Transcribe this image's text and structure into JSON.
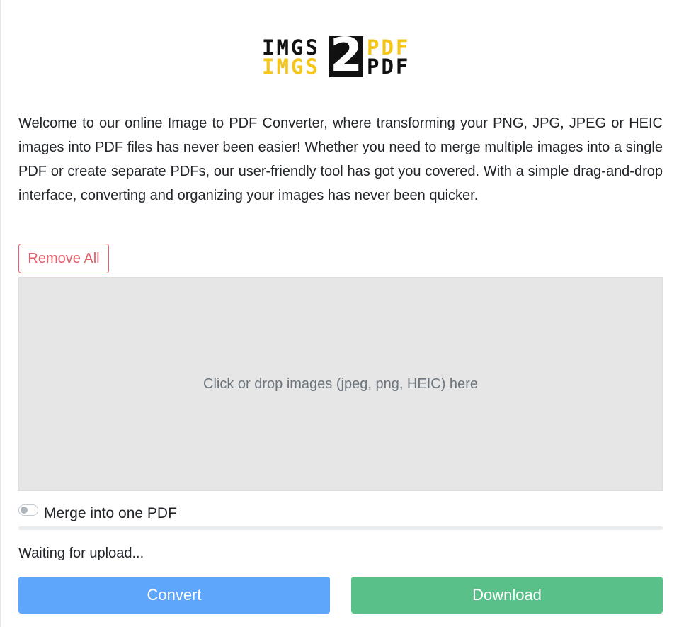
{
  "logo": {
    "imgs_top": "IMGS",
    "imgs_bottom": "IMGS",
    "two": "2",
    "pdf_top": "PDF",
    "pdf_bottom": "PDF",
    "colors": {
      "dark": "#111111",
      "yellow": "#f5c518"
    }
  },
  "intro": {
    "text": "Welcome to our online Image to PDF Converter, where transforming your PNG, JPG, JPEG or HEIC images into PDF files has never been easier! Whether you need to merge multiple images into a single PDF or create separate PDFs, our user-friendly tool has got you covered. With a simple drag-and-drop interface, converting and organizing your images has never been quicker."
  },
  "toolbar": {
    "remove_all_label": "Remove All"
  },
  "dropzone": {
    "hint": "Click or drop images (jpeg, png, HEIC) here"
  },
  "options": {
    "merge_label": "Merge into one PDF",
    "merge_enabled": false
  },
  "progress": {
    "percent": 0
  },
  "status": {
    "text": "Waiting for upload..."
  },
  "actions": {
    "convert_label": "Convert",
    "download_label": "Download"
  },
  "colors": {
    "danger": "#e4606d",
    "primary": "#5ea6fc",
    "success": "#5ac08a",
    "dropzone_bg": "#e6e6e6"
  }
}
